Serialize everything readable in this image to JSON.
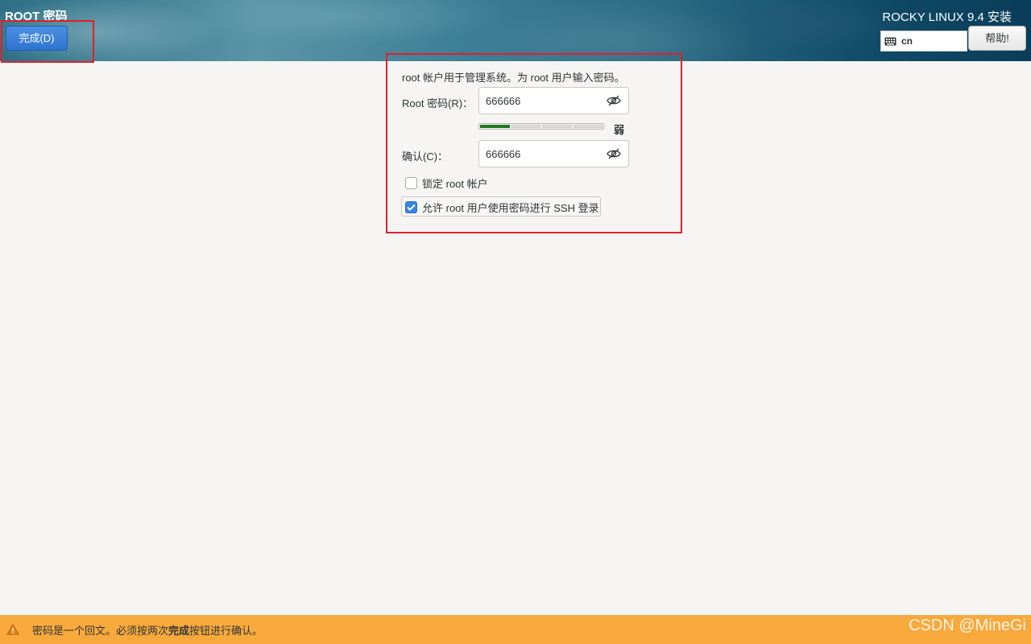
{
  "header": {
    "spoke_title": "ROOT 密码",
    "done_label": "完成(D)",
    "product_title": "ROCKY LINUX 9.4 安装",
    "keyboard_layout": "cn",
    "help_label": "帮助!"
  },
  "form": {
    "description": "root 帐户用于管理系统。为 root 用户输入密码。",
    "password_label": "Root 密码(R)：",
    "password_value": "666666",
    "confirm_label": "确认(C)：",
    "confirm_value": "666666",
    "strength": {
      "level": 1,
      "total": 4,
      "label": "弱"
    },
    "lock_root": {
      "label": "锁定 root 帐户",
      "checked": false
    },
    "allow_ssh": {
      "label": "允许 root 用户使用密码进行 SSH 登录",
      "checked": true
    }
  },
  "footer": {
    "message_prefix": "密码是一个回文。必须按两次",
    "message_bold": "完成",
    "message_suffix": "按钮进行确认。",
    "watermark": "CSDN @MineGi"
  },
  "colors": {
    "accent": "#3584e4",
    "warning_bar": "#f8a93c",
    "highlight": "#e0202a",
    "strength_fill": "#1e7a1e"
  }
}
